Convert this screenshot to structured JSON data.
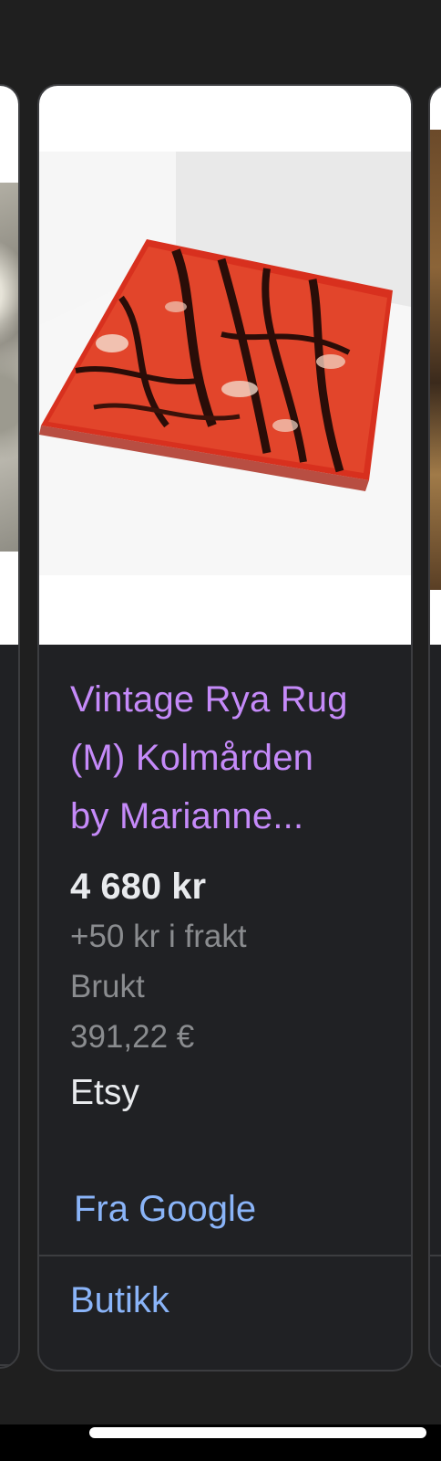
{
  "product": {
    "title_lines": [
      "Vintage Rya Rug",
      "(M) Kolmården",
      "by Marianne..."
    ],
    "price": "4 680 kr",
    "shipping": "+50 kr i frakt",
    "condition": "Brukt",
    "price_eur": "391,22 €",
    "seller": "Etsy",
    "image_alt": "Vintage Rya Rug (M) Kolmården"
  },
  "actions": {
    "from_google": "Fra Google",
    "store": "Butikk"
  },
  "colors": {
    "background": "#1f1f1f",
    "card_background": "#202124",
    "card_border": "#3c3d40",
    "title": "#c58af9",
    "price": "#e8eaed",
    "secondary_text": "#8a8c8f",
    "link": "#8ab4f8",
    "rug_red": "#d8301e",
    "rug_dark": "#2a0d08"
  },
  "icons": {
    "home_indicator": "home-indicator-bar"
  }
}
